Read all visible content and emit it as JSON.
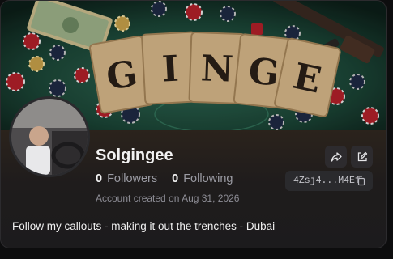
{
  "banner": {
    "letters": [
      "G",
      "I",
      "N",
      "G",
      "E"
    ],
    "alt": "banner-image"
  },
  "profile": {
    "username": "Solgingee",
    "followers_count": "0",
    "followers_label": "Followers",
    "following_count": "0",
    "following_label": "Following",
    "created": "Account created on Aug 31, 2026",
    "wallet_address": "4Zsj4...M4Ef",
    "bio": "Follow my callouts - making it out the trenches - Dubai"
  },
  "actions": {
    "share_icon": "share-icon",
    "edit_icon": "edit-icon",
    "copy_icon": "copy-icon"
  },
  "colors": {
    "card_bg": "#1c1b1d",
    "table_felt": "#1f4a3a",
    "chip_red": "#b3202a",
    "card_tan": "#d9b98a"
  }
}
